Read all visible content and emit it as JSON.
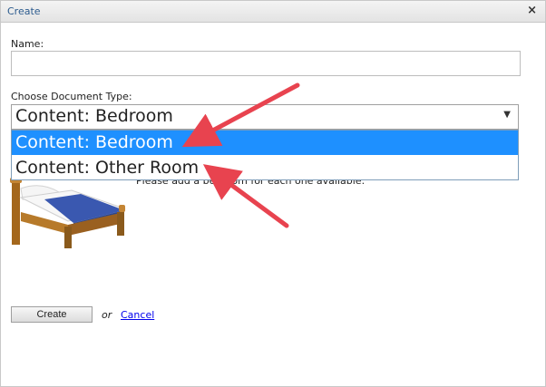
{
  "dialog": {
    "title": "Create",
    "close_glyph": "×"
  },
  "form": {
    "name_label": "Name:",
    "name_value": "",
    "doc_type_label": "Choose Document Type:",
    "doc_type_selected": "Content: Bedroom",
    "doc_type_options": [
      "Content: Bedroom",
      "Content: Other Room"
    ],
    "description": "Please add a bedroom for each one available.",
    "image_icon": "bed-icon"
  },
  "actions": {
    "create_label": "Create",
    "or_text": "or",
    "cancel_label": "Cancel"
  },
  "annotations": {
    "arrow_color": "#e8434f"
  },
  "colors": {
    "title_text": "#2c5b8e",
    "selection_highlight": "#1e90ff",
    "link": "#0000ee"
  }
}
